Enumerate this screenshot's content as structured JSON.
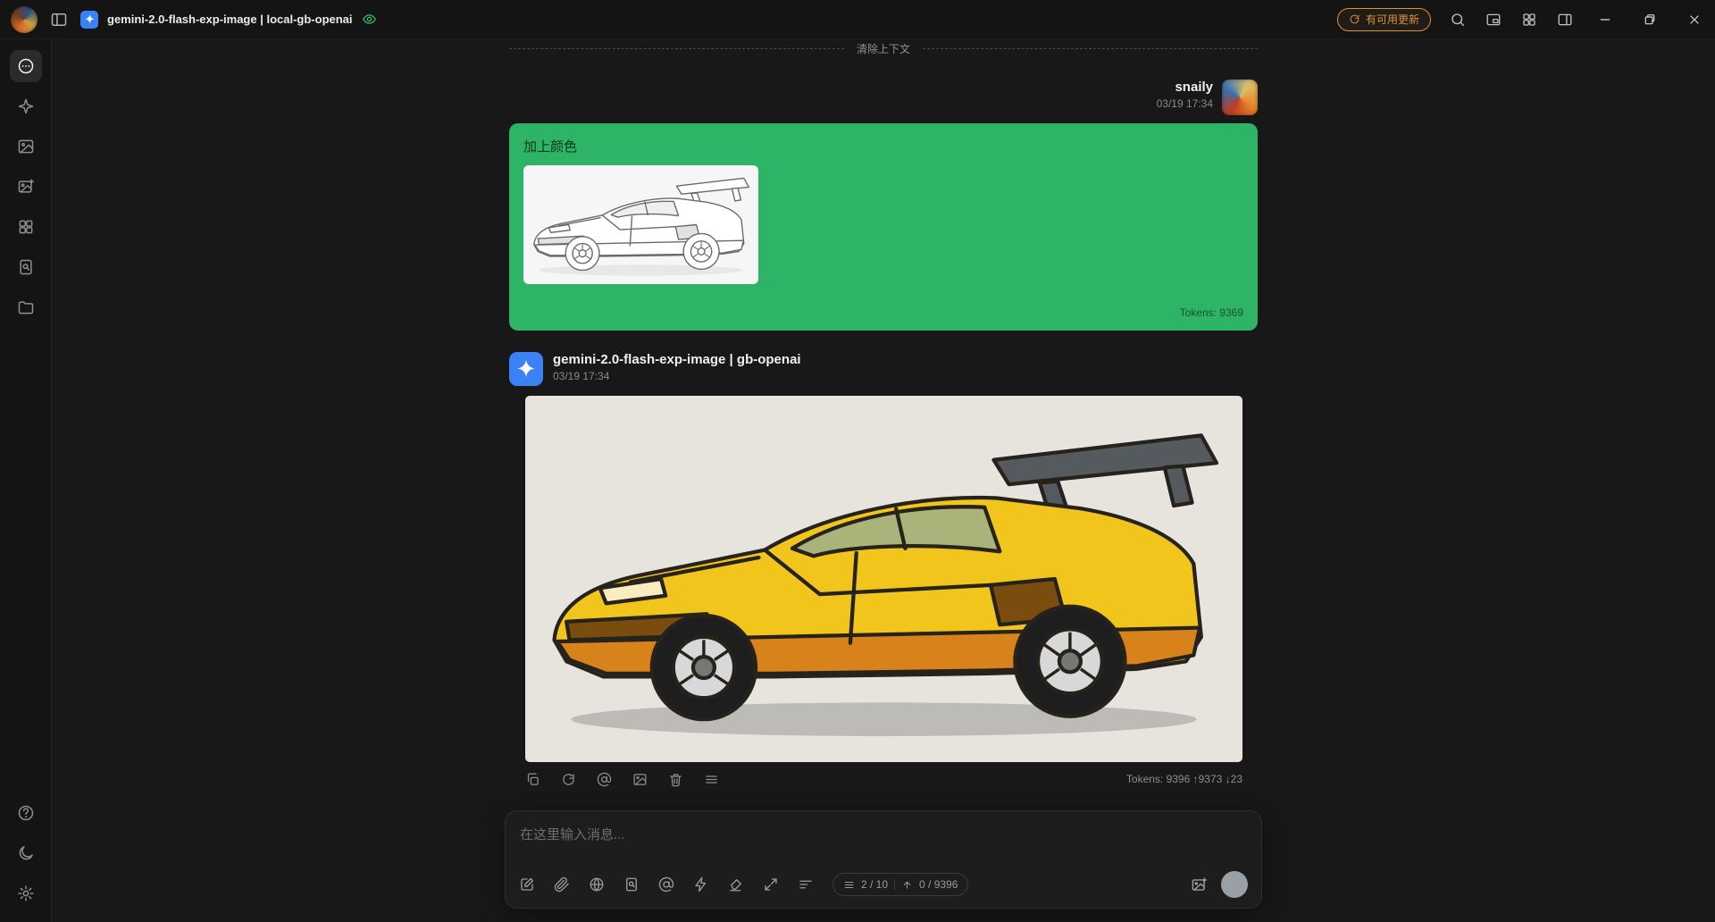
{
  "titlebar": {
    "title": "gemini-2.0-flash-exp-image | local-gb-openai",
    "update_button": "有可用更新",
    "icons": [
      "app-logo",
      "sidebar-toggle",
      "model-sparkle",
      "visibility",
      "update-refresh",
      "search",
      "mini-window",
      "apps-grid",
      "right-panel-toggle",
      "minimize",
      "restore",
      "close"
    ]
  },
  "sidebar": {
    "nav_icons": [
      "chat",
      "agents",
      "paintings",
      "image-generation",
      "mini-apps",
      "knowledge",
      "files"
    ],
    "footer_icons": [
      "help",
      "theme",
      "settings"
    ]
  },
  "chat": {
    "context_divider_label": "清除上下文",
    "messages": [
      {
        "role": "user",
        "author": "snaily",
        "time": "03/19 17:34",
        "text": "加上颜色",
        "tokens_label": "Tokens: 9369"
      },
      {
        "role": "assistant",
        "author": "gemini-2.0-flash-exp-image | gb-openai",
        "time": "03/19 17:34",
        "tokens_label": "Tokens: 9396 ↑9373 ↓23"
      }
    ],
    "message_toolbar_icons": [
      "copy",
      "regenerate",
      "mention",
      "export-image",
      "delete",
      "more"
    ]
  },
  "input": {
    "placeholder": "在这里输入消息...",
    "toolbar_icons": [
      "new-topic",
      "attach",
      "web-search",
      "knowledge",
      "mention",
      "quick-phrase",
      "clear-context",
      "expand",
      "collapse-toolbar"
    ],
    "context_pill": {
      "context_count": "2 / 10",
      "token_count": "0 / 9396"
    },
    "right_icons": [
      "image-plus",
      "send-arrow"
    ]
  },
  "colors": {
    "user_bubble": "#2eb467",
    "accent_blue": "#3b82f6",
    "update_orange": "#d8923c",
    "online_green": "#2fbf71"
  }
}
